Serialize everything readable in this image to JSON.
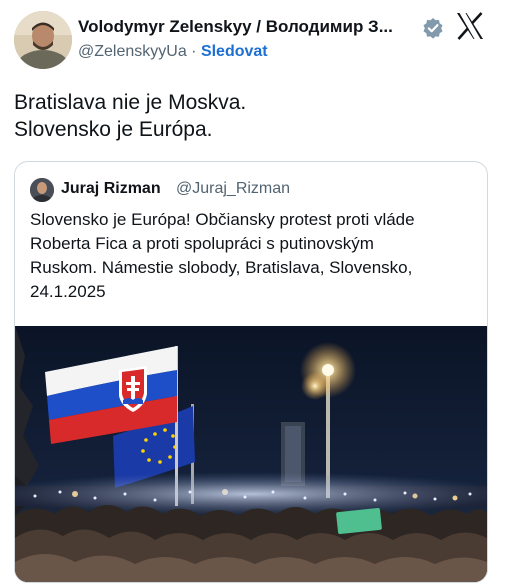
{
  "tweet": {
    "author_name": "Volodymyr Zelenskyy / Володимир З...",
    "handle": "@ZelenskyyUa",
    "separator": " · ",
    "follow_label": "Sledovat",
    "text_lines": [
      "Bratislava nie je Moskva.",
      "Slovensko je Európa."
    ],
    "verified_color": "#829aab"
  },
  "quote": {
    "author_name": "Juraj Rizman",
    "handle": "@Juraj_Rizman",
    "text_lines": [
      "Slovensko je Európa! Občiansky protest proti vláde",
      "Roberta Fica a proti spolupráci s putinovským",
      "Ruskom. Námestie slobody, Bratislava, Slovensko,",
      "24.1.2025"
    ],
    "image": "protest-photo-flags"
  },
  "icons": {
    "platform": "x-logo-icon",
    "verified": "verified-badge-icon"
  },
  "colors": {
    "follow": "#1d6fd3",
    "secondary_text": "#536471",
    "border": "#cfd9de"
  }
}
